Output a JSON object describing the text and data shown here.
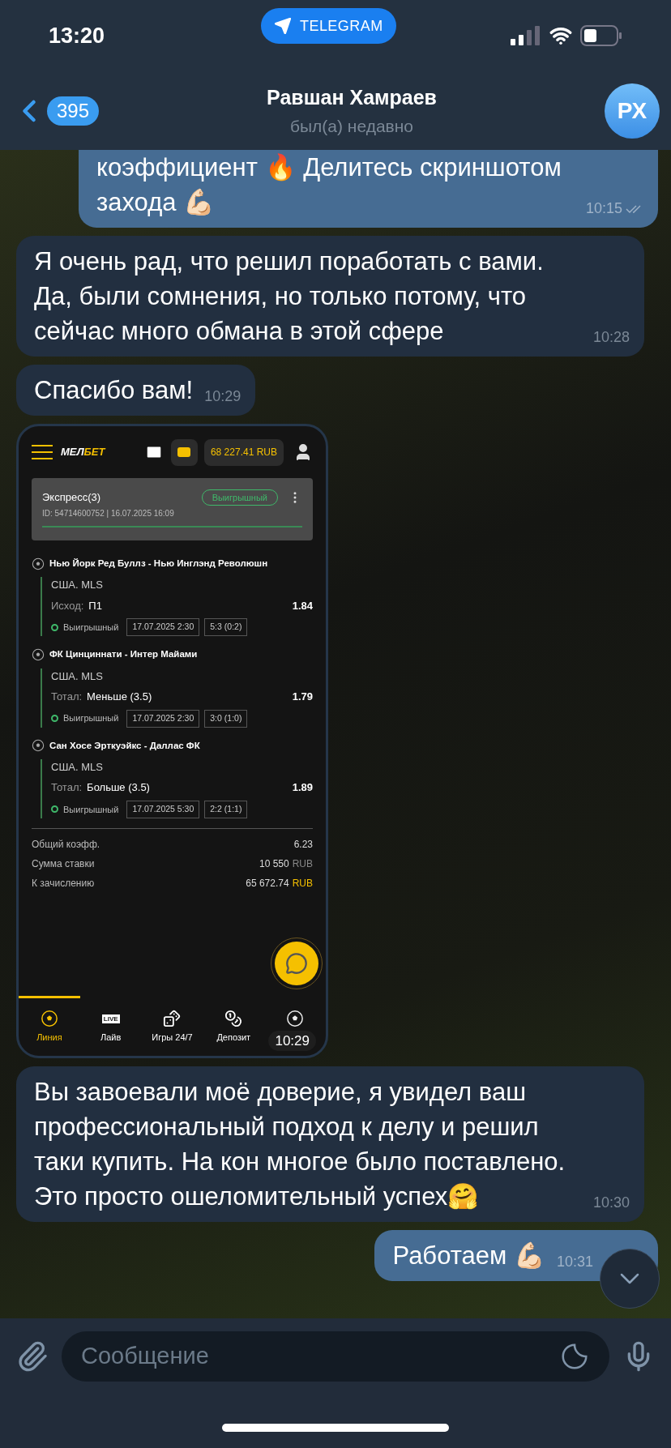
{
  "status_bar": {
    "time": "13:20",
    "app_pill": "TELEGRAM"
  },
  "header": {
    "back_count": "395",
    "name": "Равшан Хамраев",
    "status": "был(а) недавно",
    "avatar_initials": "РХ"
  },
  "messages": [
    {
      "kind": "text",
      "outgoing": true,
      "text": "коэффициент 🔥 Делитесь скриншотом захода 💪🏻",
      "time": "10:15",
      "read": true,
      "clipped_top": true
    },
    {
      "kind": "text",
      "outgoing": false,
      "text": "Я очень рад, что решил поработать с вами. Да, были сомнения, но только потому, что сейчас много обмана в этой сфере",
      "time": "10:28"
    },
    {
      "kind": "text",
      "outgoing": false,
      "text": "Спасибо вам!",
      "time": "10:29"
    },
    {
      "kind": "image",
      "outgoing": false,
      "time": "10:29"
    },
    {
      "kind": "text",
      "outgoing": false,
      "text": "Вы завоевали моё доверие, я увидел ваш профессиональный подход к делу и решил таки купить. На кон многое было поставлено. Это просто ошеломительный успех🤗",
      "time": "10:30"
    },
    {
      "kind": "text",
      "outgoing": true,
      "text": "Работаем 💪🏻",
      "time": "10:31"
    }
  ],
  "bet_slip": {
    "logo_part_1": "МЕЛ",
    "logo_part_2": "БЕТ",
    "balance": "68 227.41 RUB",
    "coupon": {
      "title": "Экспресс(3)",
      "status": "Выигрышный",
      "meta": "ID: 54714600752 | 16.07.2025 16:09",
      "level": 1
    },
    "events": [
      {
        "match": "Нью Йорк Ред Буллз - Нью Инглэнд Революшн",
        "league": "США. MLS",
        "market_label": "Исход:",
        "market_value": "П1",
        "odds": "1.84",
        "status": "Выигрышный",
        "date": "17.07.2025 2:30",
        "score": "5:3 (0:2)"
      },
      {
        "match": "ФК Цинциннати - Интер Майами",
        "league": "США. MLS",
        "market_label": "Тотал:",
        "market_value": "Меньше (3.5)",
        "odds": "1.79",
        "status": "Выигрышный",
        "date": "17.07.2025 2:30",
        "score": "3:0 (1:0)"
      },
      {
        "match": "Сан Хосе Эрткуэйкс - Даллас ФК",
        "league": "США. MLS",
        "market_label": "Тотал:",
        "market_value": "Больше (3.5)",
        "odds": "1.89",
        "status": "Выигрышный",
        "date": "17.07.2025 5:30",
        "score": "2:2 (1:1)"
      }
    ],
    "summary": [
      {
        "label": "Общий коэфф.",
        "value": "6.23"
      },
      {
        "label": "Сумма ставки",
        "value": "10 550",
        "currency": "RUB",
        "accent": false
      },
      {
        "label": "К зачислению",
        "value": "65 672.74",
        "currency": "RUB",
        "accent": true
      }
    ],
    "nav": [
      {
        "kind": "ball",
        "label": "Линия",
        "selected": true
      },
      {
        "kind": "live",
        "badge": "LIVE",
        "label": "Лайв",
        "selected": false
      },
      {
        "kind": "dice",
        "label": "Игры 24/7",
        "selected": false
      },
      {
        "kind": "coins",
        "label": "Депозит",
        "selected": false
      },
      {
        "kind": "ball",
        "selected": false
      }
    ]
  },
  "input": {
    "placeholder": "Сообщение"
  }
}
